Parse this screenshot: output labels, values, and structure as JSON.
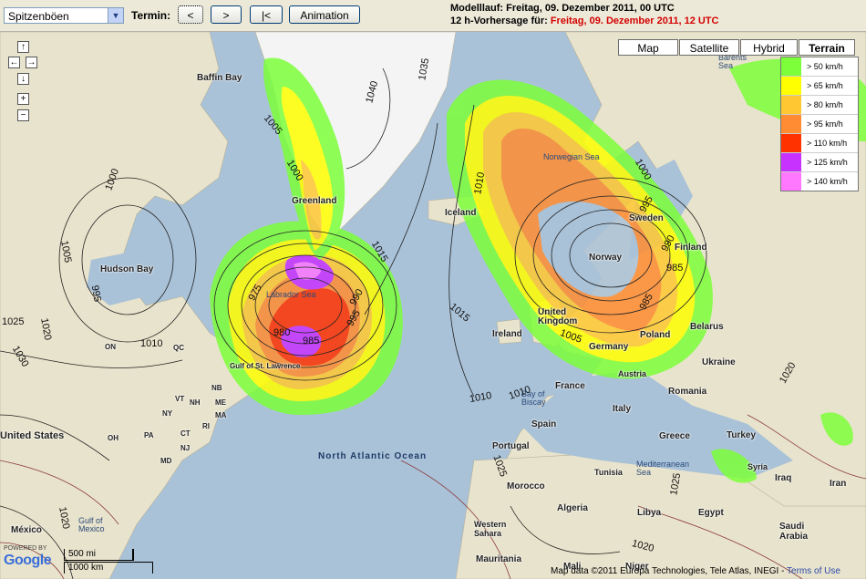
{
  "toolbar": {
    "product_value": "Spitzenböen",
    "termin_label": "Termin:",
    "prev_label": "<",
    "next_label": ">",
    "first_label": "|<",
    "animation_label": "Animation",
    "modelrun_text": "Modelllauf: Freitag, 09. Dezember 2011, 00 UTC",
    "forecast_prefix": "12 h-Vorhersage für: ",
    "forecast_time": "Freitag, 09. Dezember 2011, 12 UTC"
  },
  "map_types": [
    "Map",
    "Satellite",
    "Hybrid",
    "Terrain"
  ],
  "legend": [
    {
      "label": "> 50 km/h",
      "color": "#7dff3a"
    },
    {
      "label": "> 65 km/h",
      "color": "#ffff00"
    },
    {
      "label": "> 80 km/h",
      "color": "#ffc832"
    },
    {
      "label": "> 95 km/h",
      "color": "#ff8c32"
    },
    {
      "label": "> 110 km/h",
      "color": "#ff3200"
    },
    {
      "label": "> 125 km/h",
      "color": "#c832ff"
    },
    {
      "label": "> 140 km/h",
      "color": "#ff78ff"
    }
  ],
  "labels": {
    "baffin_bay": "Baffin Bay",
    "greenland": "Greenland",
    "hudson_bay": "Hudson Bay",
    "labrador_sea": "Labrador Sea",
    "gulf_st_lawrence": "Gulf of St. Lawrence",
    "iceland": "Iceland",
    "norwegian_sea": "Norwegian Sea",
    "norway": "Norway",
    "sweden": "Sweden",
    "finland": "Finland",
    "united_kingdom": "United Kingdom",
    "ireland": "Ireland",
    "germany": "Germany",
    "poland": "Poland",
    "belarus": "Belarus",
    "ukraine": "Ukraine",
    "austria": "Austria",
    "france": "France",
    "bay_of_biscay": "Bay of Biscay",
    "spain": "Spain",
    "portugal": "Portugal",
    "italy": "Italy",
    "romania": "Romania",
    "greece": "Greece",
    "turkey": "Turkey",
    "tunisia": "Tunisia",
    "morocco": "Morocco",
    "algeria": "Algeria",
    "libya": "Libya",
    "egypt": "Egypt",
    "syria": "Syria",
    "iraq": "Iraq",
    "iran": "Iran",
    "saudi_arabia": "Saudi Arabia",
    "western_sahara": "Western Sahara",
    "mauritania": "Mauritania",
    "mali": "Mali",
    "niger": "Niger",
    "united_states": "United States",
    "mexico": "México",
    "gulf_mexico": "Gulf of Mexico",
    "north_atlantic_ocean": "North Atlantic Ocean",
    "mediterranean_sea": "Mediterranean Sea",
    "barents_sea": "Barents Sea",
    "maine": "ME",
    "nb": "NB",
    "qc": "QC",
    "on": "ON",
    "vt": "VT",
    "ny": "NY",
    "ma": "MA",
    "ct": "CT",
    "nj": "NJ",
    "pa": "PA",
    "md": "MD",
    "oh": "OH",
    "ri": "RI",
    "nh": "NH"
  },
  "isobars": [
    "1040",
    "1035",
    "1005",
    "1000",
    "1005",
    "995",
    "1000",
    "1020",
    "1025",
    "1030",
    "1010",
    "1015",
    "1015",
    "1010",
    "1005",
    "995",
    "990",
    "985",
    "975",
    "980",
    "1000",
    "1010",
    "1025",
    "1020",
    "1025",
    "1020",
    "1020",
    "995",
    "990",
    "985",
    "985",
    "1010"
  ],
  "scale": {
    "miles": "500 mi",
    "km": "1000 km"
  },
  "google_logo": "Google",
  "powered_by": "POWERED BY",
  "copyright": "Map data ©2011 Europa Technologies, Tele Atlas, INEGI - ",
  "terms": "Terms of Use"
}
